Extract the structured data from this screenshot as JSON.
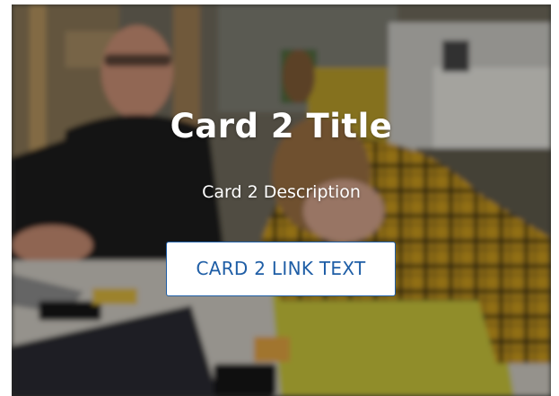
{
  "card": {
    "title": "Card 2 Title",
    "description": "Card 2 Description",
    "link_text": "CARD 2 LINK TEXT"
  },
  "colors": {
    "title_text": "#ffffff",
    "link_border": "#1f5ea6",
    "link_text": "#1f5ea6",
    "link_background": "#ffffff"
  }
}
